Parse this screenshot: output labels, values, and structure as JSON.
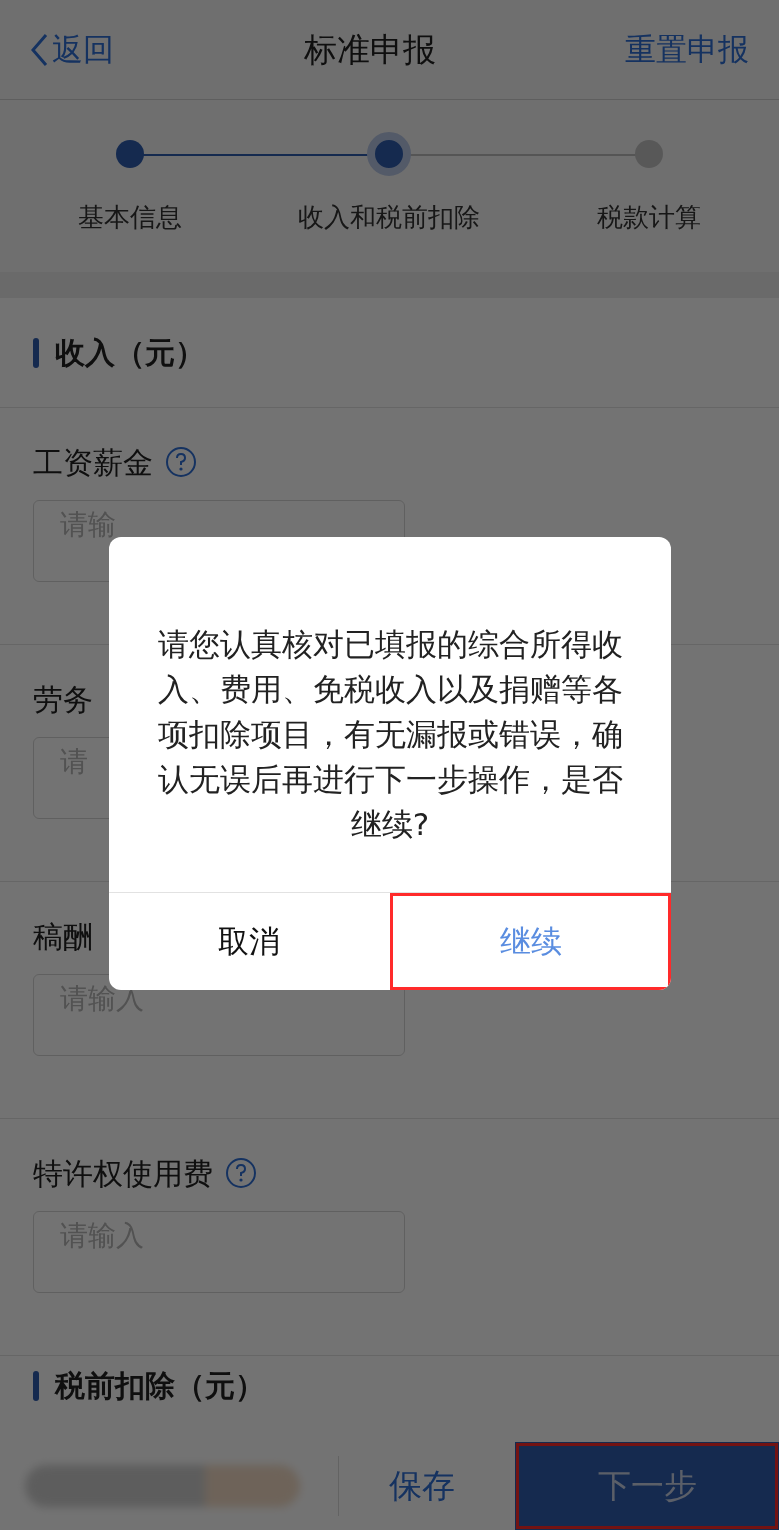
{
  "nav": {
    "back": "返回",
    "title": "标准申报",
    "action": "重置申报"
  },
  "steps": [
    {
      "label": "基本信息",
      "done": true,
      "selected": false
    },
    {
      "label": "收入和税前扣除",
      "done": true,
      "selected": true
    },
    {
      "label": "税款计算",
      "done": false,
      "selected": false
    }
  ],
  "income_section": {
    "title": "收入（元）",
    "fields": [
      {
        "label": "工资薪金",
        "help": true,
        "placeholder": "请输"
      },
      {
        "label": "劳务",
        "help": false,
        "placeholder": "请"
      },
      {
        "label": "稿酬",
        "help": false,
        "placeholder": "请输入"
      },
      {
        "label": "特许权使用费",
        "help": true,
        "placeholder": "请输入"
      }
    ]
  },
  "deduction_section": {
    "title": "税前扣除（元）"
  },
  "bottom_bar": {
    "save": "保存",
    "next": {
      "label": "下一步",
      "annotated": true
    }
  },
  "dialog": {
    "message": "请您认真核对已填报的综合所得收入、费用、免税收入以及捐赠等各项扣除项目，有无漏报或错误，确认无误后再进行下一步操作，是否继续?",
    "buttons": [
      {
        "label": "取消",
        "kind": "cancel",
        "annotated": false
      },
      {
        "label": "继续",
        "kind": "confirm",
        "annotated": true
      }
    ]
  }
}
